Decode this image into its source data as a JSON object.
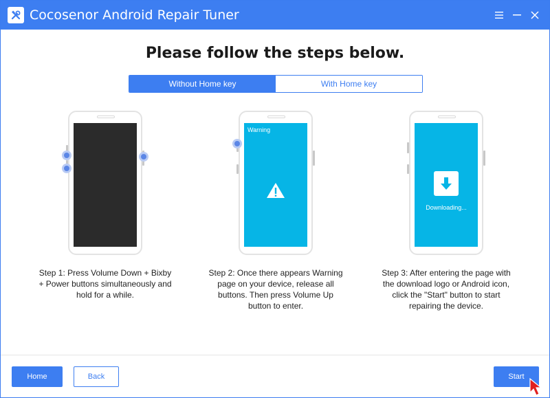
{
  "window": {
    "title": "Cocosenor Android Repair Tuner",
    "accent": "#3d7ef1",
    "app_icon": "wrench-screwdriver-icon"
  },
  "heading": "Please follow the steps below.",
  "tabs": [
    {
      "label": "Without Home key",
      "active": true
    },
    {
      "label": "With Home key",
      "active": false
    }
  ],
  "steps": [
    {
      "text": "Step 1: Press Volume Down + Bixby + Power buttons simultaneously and hold for a while.",
      "screen": "dark"
    },
    {
      "text": "Step 2: Once there appears Warning page on your device, release all buttons. Then press Volume Up button to enter.",
      "screen_label": "Warning",
      "icon": "warning-icon"
    },
    {
      "text": "Step 3: After entering the page with the download logo or Android icon, click the \"Start\" button to start repairing the device.",
      "screen_label": "Downloading...",
      "icon": "download-icon"
    }
  ],
  "footer": {
    "home_label": "Home",
    "back_label": "Back",
    "start_label": "Start"
  }
}
